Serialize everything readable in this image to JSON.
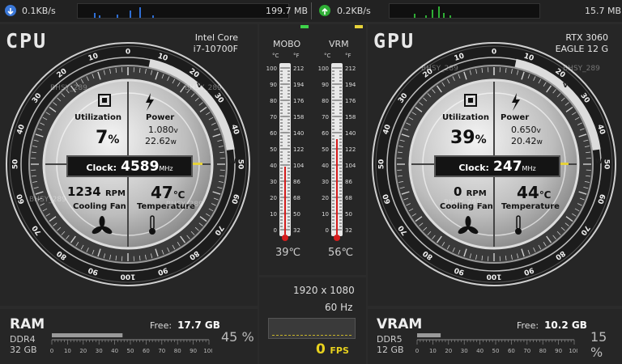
{
  "network": {
    "download_rate": "0.1KB/s",
    "download_total": "199.7 MB",
    "upload_rate": "0.2KB/s",
    "upload_total": "15.7 MB",
    "download_icon": "arrow-down-circle-icon",
    "upload_icon": "arrow-up-circle-icon",
    "download_color": "#2f6fd6",
    "upload_color": "#2fae35"
  },
  "cpu": {
    "title": "CPU",
    "model_line1": "Intel Core",
    "model_line2": "i7-10700F",
    "utilization_label": "Utilization",
    "utilization_value": "7",
    "utilization_unit": "%",
    "power_label": "Power",
    "power_voltage": "1.080",
    "power_voltage_unit": "v",
    "power_watts": "22.62",
    "power_watts_unit": "w",
    "clock_label": "Clock:",
    "clock_value": "4589",
    "clock_unit": "MHz",
    "fan_value": "1234",
    "fan_unit": "RPM",
    "fan_label": "Cooling Fan",
    "temp_value": "47",
    "temp_unit": "℃",
    "temp_label": "Temperature",
    "watermark": "BHSY_289",
    "gauge_labels": [
      "0",
      "10",
      "20",
      "30",
      "40",
      "50",
      "60",
      "70",
      "80",
      "90",
      "100"
    ],
    "arc_letters": [
      "V",
      "W"
    ]
  },
  "gpu": {
    "title": "GPU",
    "model_line1": "RTX 3060",
    "model_line2": "EAGLE 12 G",
    "utilization_label": "Utilization",
    "utilization_value": "39",
    "utilization_unit": "%",
    "power_label": "Power",
    "power_voltage": "0.650",
    "power_voltage_unit": "v",
    "power_watts": "20.42",
    "power_watts_unit": "w",
    "clock_label": "Clock:",
    "clock_value": "247",
    "clock_unit": "MHz",
    "fan_value": "0",
    "fan_unit": "RPM",
    "fan_label": "Cooling Fan",
    "temp_value": "44",
    "temp_unit": "℃",
    "temp_label": "Temperature",
    "watermark": "BHSY_289",
    "gauge_labels": [
      "0",
      "10",
      "20",
      "30",
      "40",
      "50",
      "60",
      "70",
      "80",
      "90",
      "100"
    ],
    "arc_letters": [
      "V",
      "W"
    ]
  },
  "thermometers": {
    "mobo_label": "MOBO",
    "vrm_label": "VRM",
    "unit_c": "°C",
    "unit_f": "°F",
    "c_ticks": [
      "100",
      "90",
      "80",
      "70",
      "60",
      "50",
      "40",
      "30",
      "20",
      "10",
      "0"
    ],
    "f_ticks": [
      "212",
      "194",
      "176",
      "158",
      "140",
      "122",
      "104",
      "86",
      "68",
      "50",
      "32"
    ],
    "mobo_temp": "39℃",
    "vrm_temp": "56℃",
    "mobo_value": 39,
    "vrm_value": 56
  },
  "display": {
    "resolution": "1920 x 1080",
    "refresh": "60 Hz",
    "fps_value": "0",
    "fps_unit": "FPS"
  },
  "ram": {
    "title": "RAM",
    "type": "DDR4",
    "size": "32 GB",
    "free_label": "Free:",
    "free_value": "17.7 GB",
    "percent": "45 %",
    "usage": 45,
    "scale": [
      "0",
      "10",
      "20",
      "30",
      "40",
      "50",
      "60",
      "70",
      "80",
      "90",
      "100"
    ]
  },
  "vram": {
    "title": "VRAM",
    "type": "DDR5",
    "size": "12 GB",
    "free_label": "Free:",
    "free_value": "10.2 GB",
    "percent": "15 %",
    "usage": 15,
    "scale": [
      "0",
      "10",
      "20",
      "30",
      "40",
      "50",
      "60",
      "70",
      "80",
      "90",
      "100"
    ]
  }
}
